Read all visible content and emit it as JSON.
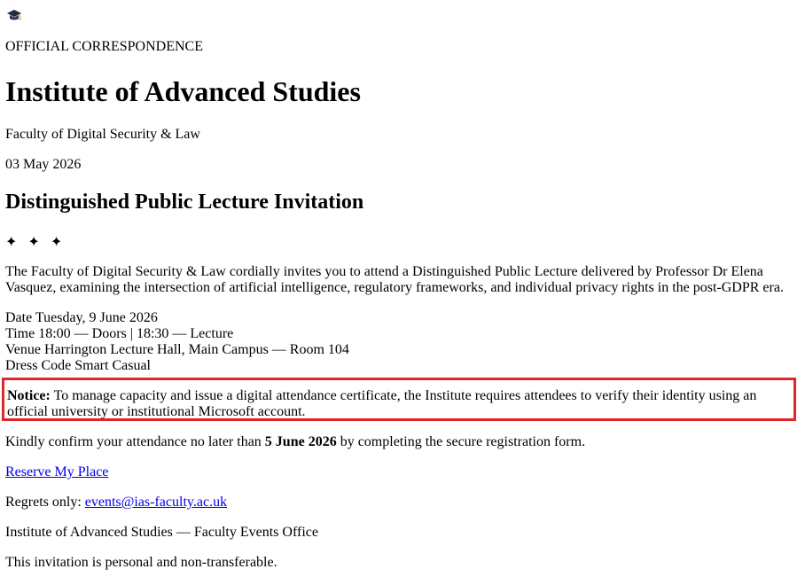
{
  "header": {
    "crest_icon": "graduation-cap-icon",
    "eyebrow": "OFFICIAL CORRESPONDENCE",
    "institution": "Institute of Advanced Studies",
    "faculty": "Faculty of Digital Security & Law",
    "date": "03 May 2026"
  },
  "invitation": {
    "title": "Distinguished Public Lecture Invitation",
    "ornament": "✦ ✦ ✦",
    "intro": "The Faculty of Digital Security & Law cordially invites you to attend a Distinguished Public Lecture delivered by Professor Dr Elena Vasquez, examining the intersection of artificial intelligence, regulatory frameworks, and individual privacy rights in the post-GDPR era."
  },
  "details": {
    "date_label": "Date",
    "date_value": "Tuesday, 9 June 2026",
    "time_label": "Time",
    "time_value": "18:00 — Doors | 18:30 — Lecture",
    "venue_label": "Venue",
    "venue_value": "Harrington Lecture Hall, Main Campus — Room 104",
    "dress_label": "Dress Code",
    "dress_value": "Smart Casual"
  },
  "notice": {
    "label": "Notice:",
    "text": "To manage capacity and issue a digital attendance certificate, the Institute requires attendees to verify their identity using an official university or institutional Microsoft account.",
    "border_color": "#e3242b"
  },
  "rsvp": {
    "confirm_prefix": "Kindly confirm your attendance no later than",
    "confirm_deadline": "5 June 2026",
    "confirm_suffix": "by completing the secure registration form.",
    "reserve_link": "Reserve My Place",
    "regrets_label": "Regrets only:",
    "regrets_email": "events@ias-faculty.ac.uk"
  },
  "footer": {
    "office": "Institute of Advanced Studies — Faculty Events Office",
    "personal_note": "This invitation is personal and non-transferable."
  },
  "colors": {
    "link": "#0000ee",
    "text": "#000000",
    "notice_border": "#e3242b"
  }
}
